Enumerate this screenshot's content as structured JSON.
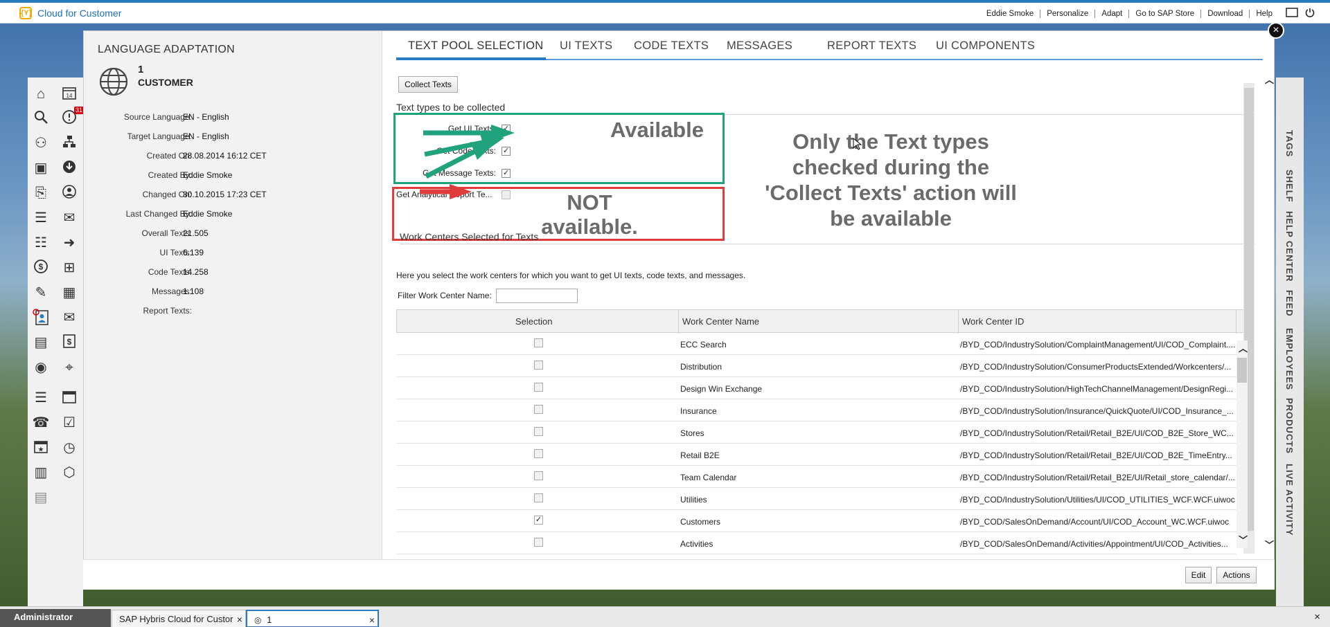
{
  "app": {
    "title": "Cloud for Customer",
    "logo": "{Y}"
  },
  "topnav": [
    "Eddie Smoke",
    "Personalize",
    "Adapt",
    "Go to SAP Store",
    "Download",
    "Help"
  ],
  "left": {
    "title": "LANGUAGE ADAPTATION",
    "object_number": "1",
    "object_name": "CUSTOMER",
    "fields": [
      {
        "label": "Source Language:",
        "value": "EN - English"
      },
      {
        "label": "Target Language:",
        "value": "EN - English"
      },
      {
        "label": "Created On:",
        "value": "28.08.2014 16:12 CET"
      },
      {
        "label": "Created By:",
        "value": "Eddie Smoke"
      },
      {
        "label": "Changed On:",
        "value": "30.10.2015 17:23 CET"
      },
      {
        "label": "Last Changed By:",
        "value": "Eddie Smoke"
      },
      {
        "label": "Overall Texts:",
        "value": "21.505"
      },
      {
        "label": "UI Texts:",
        "value": "6.139"
      },
      {
        "label": "Code Texts:",
        "value": "14.258"
      },
      {
        "label": "Messages:",
        "value": "1.108"
      },
      {
        "label": "Report Texts:",
        "value": ""
      }
    ]
  },
  "tabs": [
    "TEXT POOL SELECTION",
    "UI TEXTS",
    "CODE TEXTS",
    "MESSAGES",
    "REPORT TEXTS",
    "UI COMPONENTS"
  ],
  "collect_button": "Collect Texts",
  "text_types_header": "Text types to be collected",
  "text_types": [
    {
      "label": "Get UI Texts:",
      "checked": true
    },
    {
      "label": "Get Code Texts:",
      "checked": true
    },
    {
      "label": "Get Message Texts:",
      "checked": true
    },
    {
      "label": "Get Analytical Report Te...",
      "checked": false
    }
  ],
  "callouts": {
    "available": "Available",
    "not_available_1": "NOT",
    "not_available_2": "available.",
    "note_1": "Only the Text types",
    "note_2": "checked during the",
    "note_3": "'Collect Texts' action will",
    "note_4": "be available"
  },
  "work_centers": {
    "header": "Work Centers Selected for Texts",
    "description": "Here you select the work centers for which you want to get UI texts, code texts, and messages.",
    "filter_label": "Filter Work Center Name:",
    "filter_value": "",
    "columns": [
      "Selection",
      "Work Center Name",
      "Work Center ID"
    ],
    "rows": [
      {
        "name": "ECC Search",
        "id": "/BYD_COD/IndustrySolution/ComplaintManagement/UI/COD_Complaint....",
        "checked": false
      },
      {
        "name": "Distribution",
        "id": "/BYD_COD/IndustrySolution/ConsumerProductsExtended/Workcenters/...",
        "checked": false
      },
      {
        "name": "Design Win Exchange",
        "id": "/BYD_COD/IndustrySolution/HighTechChannelManagement/DesignRegi...",
        "checked": false
      },
      {
        "name": "Insurance",
        "id": "/BYD_COD/IndustrySolution/Insurance/QuickQuote/UI/COD_Insurance_...",
        "checked": false
      },
      {
        "name": "Stores",
        "id": "/BYD_COD/IndustrySolution/Retail/Retail_B2E/UI/COD_B2E_Store_WC...",
        "checked": false
      },
      {
        "name": "Retail B2E",
        "id": "/BYD_COD/IndustrySolution/Retail/Retail_B2E/UI/COD_B2E_TimeEntry...",
        "checked": false
      },
      {
        "name": "Team Calendar",
        "id": "/BYD_COD/IndustrySolution/Retail/Retail_B2E/UI/Retail_store_calendar/...",
        "checked": false
      },
      {
        "name": "Utilities",
        "id": "/BYD_COD/IndustrySolution/Utilities/UI/COD_UTILITIES_WCF.WCF.uiwoc",
        "checked": false
      },
      {
        "name": "Customers",
        "id": "/BYD_COD/SalesOnDemand/Account/UI/COD_Account_WC.WCF.uiwoc",
        "checked": true
      },
      {
        "name": "Activities",
        "id": "/BYD_COD/SalesOnDemand/Activities/Appointment/UI/COD_Activities...",
        "checked": false
      }
    ]
  },
  "footer": {
    "edit": "Edit",
    "actions": "Actions"
  },
  "shelf": [
    "TAGS",
    "SHELF",
    "HELP CENTER",
    "FEED",
    "EMPLOYEES",
    "PRODUCTS",
    "LIVE ACTIVITY"
  ],
  "taskbar": {
    "user": "Administrator",
    "tabs": [
      "SAP Hybris Cloud for Custor",
      "1"
    ]
  },
  "calendar_day": "14",
  "notification_count": "31",
  "colors": {
    "accent": "#2b7bc0",
    "green_box": "#20a37d",
    "red_box": "#e03c3c"
  }
}
